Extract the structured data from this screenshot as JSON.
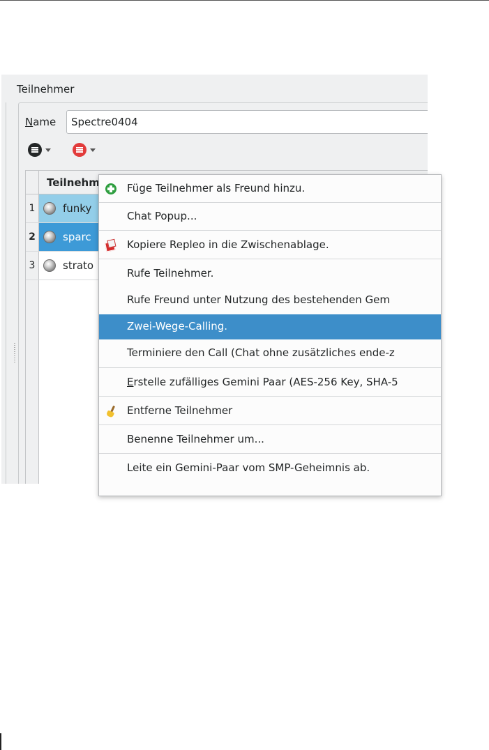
{
  "panel": {
    "title": "Teilnehmer"
  },
  "form": {
    "name_label_prefix": "N",
    "name_label_rest": "ame",
    "name_value": "Spectre0404"
  },
  "toolbar": {
    "button1": {
      "icon": "list-dark-icon",
      "color": "#232627"
    },
    "button2": {
      "icon": "list-red-icon",
      "color": "#e23b3b"
    }
  },
  "table": {
    "column_header": "Teilnehmer",
    "rows": [
      {
        "num": "1",
        "name": "funky",
        "status": "offline-ball-icon"
      },
      {
        "num": "2",
        "name": "sparc",
        "status": "offline-ball-icon"
      },
      {
        "num": "3",
        "name": "strato",
        "status": "offline-ball-icon"
      }
    ]
  },
  "context_menu": {
    "items": [
      {
        "label": "Füge Teilnehmer als Freund hinzu.",
        "icon": "add-friend-icon"
      },
      {
        "label": "Chat Popup..."
      },
      {
        "label": "Kopiere Repleo in die Zwischenablage.",
        "icon": "copy-icon"
      },
      {
        "label": "Rufe Teilnehmer."
      },
      {
        "label": "Rufe Freund unter Nutzung des bestehenden Gem"
      },
      {
        "label": "Zwei-Wege-Calling.",
        "highlighted": true
      },
      {
        "label": "Terminiere den Call (Chat ohne zusätzliches ende-z"
      },
      {
        "label_prefix": "E",
        "label_rest": "rstelle zufälliges Gemini Paar (AES-256 Key, SHA-5"
      },
      {
        "label": "Entferne Teilnehmer",
        "icon": "broom-icon"
      },
      {
        "label": "Benenne Teilnehmer um..."
      },
      {
        "label": "Leite ein Gemini-Paar vom SMP-Geheimnis ab."
      }
    ]
  },
  "colors": {
    "highlight": "#3d8ec9",
    "row_selected": "#3d9ad7",
    "row_selected_light": "#93cee9"
  }
}
